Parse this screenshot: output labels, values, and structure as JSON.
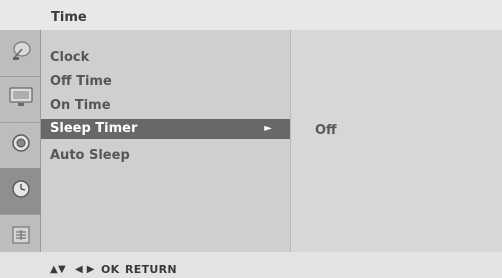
{
  "menu": {
    "title": "Time",
    "items": [
      {
        "label": "Clock"
      },
      {
        "label": "Off Time"
      },
      {
        "label": "On Time"
      },
      {
        "label": "Sleep Timer",
        "selected": true
      },
      {
        "label": "Auto Sleep"
      }
    ],
    "selected_value": "Off"
  },
  "sidebar_icons": [
    "satellite-dish-icon",
    "tv-picture-icon",
    "speaker-sound-icon",
    "clock-time-icon",
    "option-grid-icon"
  ],
  "footer": {
    "updown": "▲▼",
    "leftright": "◀ ▶",
    "ok": "OK",
    "return": "RETURN"
  },
  "colors": {
    "highlight": "#686868",
    "panel": "#cfcfcf",
    "active_icon": "#8f8f8f"
  }
}
